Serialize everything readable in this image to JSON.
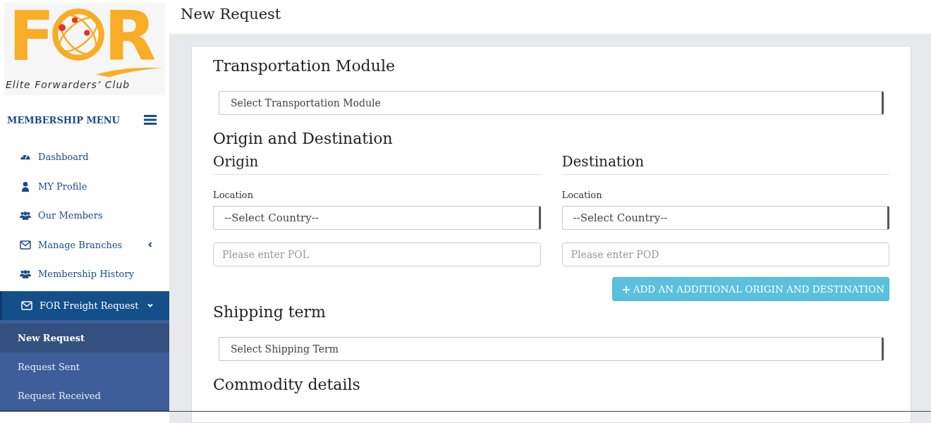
{
  "logo": {
    "left_letter": "F",
    "right_letter": "R",
    "tagline": "Elite Forwarders’ Club"
  },
  "menu": {
    "title": "MEMBERSHIP MENU",
    "items": [
      {
        "label": "Dashboard",
        "kind": "gauge",
        "selected": false
      },
      {
        "label": "MY Profile",
        "kind": "user",
        "selected": false
      },
      {
        "label": "Our Members",
        "kind": "users",
        "selected": false
      },
      {
        "label": "Manage Branches",
        "kind": "envelope",
        "selected": false,
        "expanded": false
      },
      {
        "label": "Membership History",
        "kind": "users",
        "selected": false
      },
      {
        "label": "FOR Freight Request",
        "kind": "envelope",
        "selected": true,
        "expanded": true,
        "children": [
          {
            "label": "New Request",
            "selected": true
          },
          {
            "label": "Request Sent",
            "selected": false
          },
          {
            "label": "Request Received",
            "selected": false
          }
        ]
      }
    ]
  },
  "page_title": "New Request",
  "form": {
    "transport": {
      "heading": "Transportation Module",
      "select": "Select Transportation Module"
    },
    "route": {
      "heading": "Origin and Destination",
      "columns": [
        {
          "heading": "Origin",
          "label": "Location",
          "select": "--Select Country--",
          "placeholder": "Please enter POL"
        },
        {
          "heading": "Destination",
          "label": "Location",
          "select": "--Select Country--",
          "placeholder": "Please enter POD"
        }
      ],
      "add_button": {
        "icon": "+",
        "label": "ADD AN ADDITIONAL ORIGIN AND DESTINATION"
      }
    },
    "shipping": {
      "heading": "Shipping term",
      "select": "Select Shipping Term"
    },
    "commodity": {
      "heading": "Commodity details"
    }
  }
}
